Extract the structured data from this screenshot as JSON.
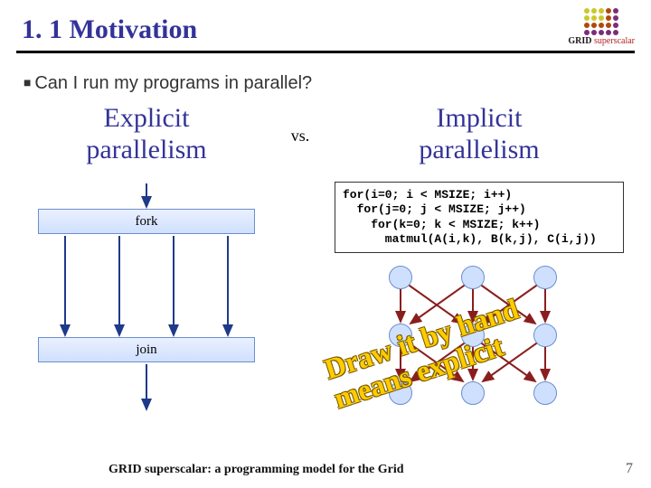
{
  "title": "1. 1 Motivation",
  "logo": {
    "brand": "GRID",
    "sub": "superscalar"
  },
  "bullet": "Can I run my programs in parallel?",
  "left": {
    "heading_l1": "Explicit",
    "heading_l2": "parallelism",
    "fork_label": "fork",
    "join_label": "join"
  },
  "vs": "vs.",
  "right": {
    "heading_l1": "Implicit",
    "heading_l2": "parallelism",
    "code": "for(i=0; i < MSIZE; i++)\n  for(j=0; j < MSIZE; j++)\n    for(k=0; k < MSIZE; k++)\n      matmul(A(i,k), B(k,j), C(i,j))"
  },
  "stamp": "Draw it by hand\nmeans explicit",
  "footer": "GRID superscalar: a programming model for the Grid",
  "page_number": "7"
}
